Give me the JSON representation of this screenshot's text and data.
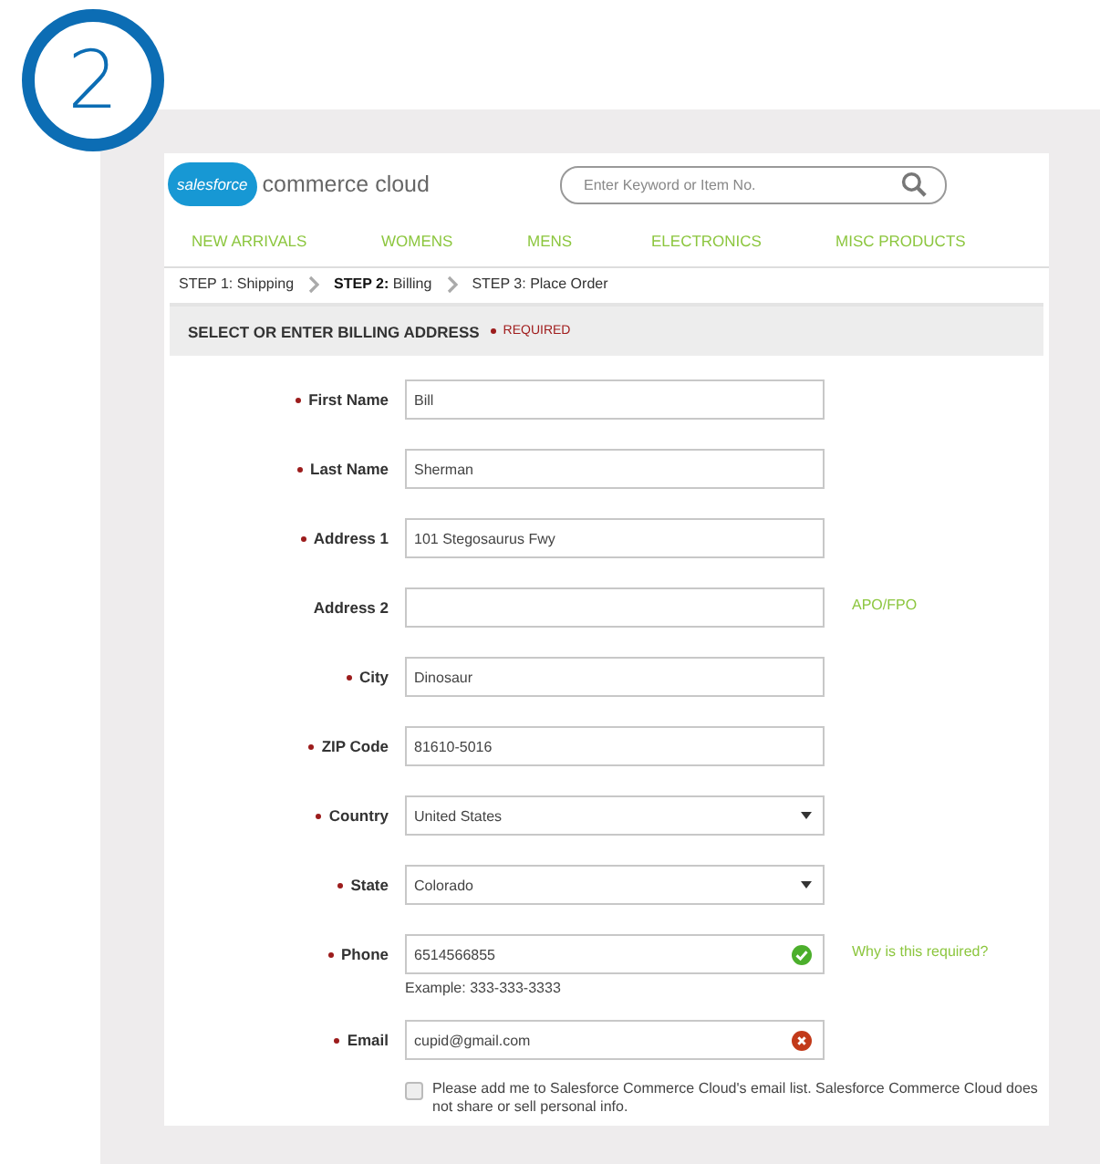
{
  "step_badge": "2",
  "header": {
    "logo_mark": "salesforce",
    "logo_text": "commerce cloud",
    "search": {
      "placeholder": "Enter Keyword or Item No."
    }
  },
  "nav": [
    "NEW ARRIVALS",
    "WOMENS",
    "MENS",
    "ELECTRONICS",
    "MISC PRODUCTS"
  ],
  "breadcrumb": [
    {
      "step": "STEP 1:",
      "label": "Shipping",
      "selected": false
    },
    {
      "step": "STEP 2:",
      "label": "Billing",
      "selected": true
    },
    {
      "step": "STEP 3:",
      "label": "Place Order",
      "selected": false
    }
  ],
  "section": {
    "title": "SELECT OR ENTER BILLING ADDRESS",
    "required_note": "REQUIRED"
  },
  "fields": [
    {
      "kind": "text",
      "label": "First Name",
      "required": true,
      "value": "Bill",
      "valid": false,
      "error": false
    },
    {
      "kind": "text",
      "label": "Last Name",
      "required": true,
      "value": "Sherman",
      "valid": false,
      "error": false
    },
    {
      "kind": "text",
      "label": "Address 1",
      "required": true,
      "value": "101 Stegosaurus Fwy",
      "valid": false,
      "error": false
    },
    {
      "kind": "text",
      "label": "Address 2",
      "required": false,
      "valid": false,
      "error": false,
      "side_link": "APO/FPO"
    },
    {
      "kind": "text",
      "label": "City",
      "required": true,
      "value": "Dinosaur",
      "valid": false,
      "error": false
    },
    {
      "kind": "text",
      "label": "ZIP Code",
      "required": true,
      "value": "81610-5016",
      "valid": false,
      "error": false
    },
    {
      "kind": "select",
      "label": "Country",
      "required": true,
      "value": "United States"
    },
    {
      "kind": "select",
      "label": "State",
      "required": true,
      "value": "Colorado"
    },
    {
      "kind": "text",
      "label": "Phone",
      "required": true,
      "value": "6514566855",
      "valid": true,
      "error": false,
      "side_link": "Why is this required?",
      "hint": "Example: 333-333-3333"
    },
    {
      "kind": "text",
      "label": "Email",
      "required": true,
      "value": "cupid@gmail.com",
      "valid": false,
      "error": true
    }
  ],
  "opt_in": {
    "label": "Please add me to Salesforce Commerce Cloud's email list. Salesforce Commerce Cloud does not share or sell personal info.",
    "checked": false
  }
}
